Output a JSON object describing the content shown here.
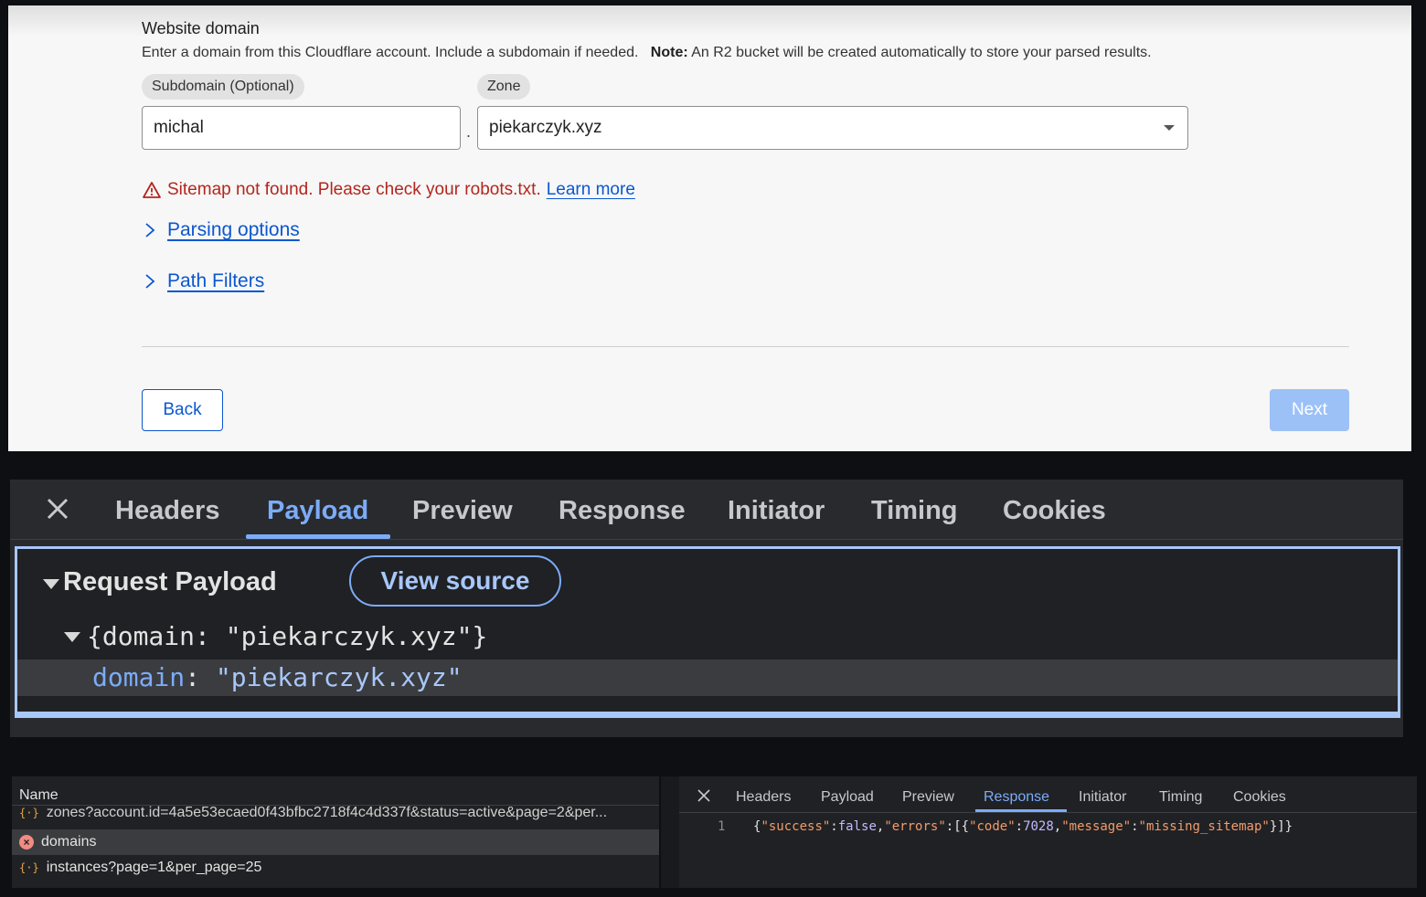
{
  "form": {
    "section_title": "Website domain",
    "description": "Enter a domain from this Cloudflare account. Include a subdomain if needed.",
    "note_label": "Note:",
    "note_text": "An R2 bucket will be created automatically to store your parsed results.",
    "subdomain_label": "Subdomain (Optional)",
    "subdomain_value": "michal",
    "separator": ".",
    "zone_label": "Zone",
    "zone_value": "piekarczyk.xyz",
    "error_text": "Sitemap not found. Please check your robots.txt.",
    "error_link": "Learn more",
    "parsing_options": "Parsing options",
    "path_filters": "Path Filters",
    "back_label": "Back",
    "next_label": "Next",
    "colors": {
      "error": "#b3261e",
      "link": "#0b57d0",
      "next_disabled": "#9cc1f7"
    }
  },
  "devtools_large": {
    "tabs": [
      "Headers",
      "Payload",
      "Preview",
      "Response",
      "Initiator",
      "Timing",
      "Cookies"
    ],
    "active_tab": "Payload",
    "request_payload_title": "Request Payload",
    "view_source_label": "View source",
    "object_summary": "{domain: \"piekarczyk.xyz\"}",
    "prop_key": "domain",
    "prop_value": "\"piekarczyk.xyz\""
  },
  "network": {
    "column_name": "Name",
    "rows": [
      {
        "icon": "json-icon",
        "name": "zones?account.id=4a5e53ecaed0f43bfbc2718f4c4d337f&status=active&page=2&per..."
      },
      {
        "icon": "error-icon",
        "name": "domains"
      },
      {
        "icon": "json-icon",
        "name": "instances?page=1&per_page=25"
      }
    ]
  },
  "response_panel": {
    "tabs": [
      "Headers",
      "Payload",
      "Preview",
      "Response",
      "Initiator",
      "Timing",
      "Cookies"
    ],
    "active_tab": "Response",
    "line_number": "1",
    "json": {
      "open": "{",
      "k_success": "\"success\"",
      "v_success": "false",
      "k_errors": "\"errors\"",
      "k_code": "\"code\"",
      "v_code": "7028",
      "k_message": "\"message\"",
      "v_message": "\"missing_sitemap\"",
      "close": "}]}"
    }
  }
}
